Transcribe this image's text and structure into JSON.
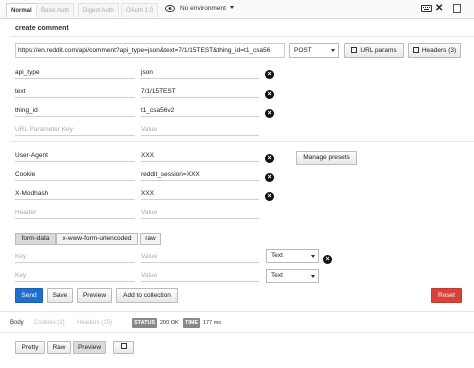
{
  "topbar": {
    "tabs": [
      "Normal",
      "Basic Auth",
      "Digest Auth",
      "OAuth 1.0"
    ],
    "environment": "No environment"
  },
  "request": {
    "title": "create comment",
    "url": "https://en.reddit.com/api/comment?api_type=json&text=7/1/15TEST&thing_id=t1_csa56",
    "method": "POST",
    "url_params_label": "URL params",
    "headers_label": "Headers (3)"
  },
  "params": [
    {
      "key": "api_type",
      "value": "json"
    },
    {
      "key": "text",
      "value": "7/1/15TEST"
    },
    {
      "key": "thing_id",
      "value": "t1_csa56v2"
    }
  ],
  "params_placeholder": {
    "key": "URL Parameter Key",
    "value": "Value"
  },
  "headers": [
    {
      "key": "User-Agent",
      "value": "XXX"
    },
    {
      "key": "Cookie",
      "value": "reddit_session=XXX"
    },
    {
      "key": "X-Modhash",
      "value": "XXX"
    }
  ],
  "headers_placeholder": {
    "key": "Header",
    "value": "Value"
  },
  "manage_presets_label": "Manage presets",
  "body_tabs": [
    "form-data",
    "x-www-form-urlencoded",
    "raw"
  ],
  "form_rows": [
    {
      "key": "Key",
      "value": "Value",
      "type": "Text"
    },
    {
      "key": "Key",
      "value": "Value",
      "type": "Text"
    }
  ],
  "actions": {
    "send": "Send",
    "save": "Save",
    "preview": "Preview",
    "add_to_collection": "Add to collection",
    "reset": "Reset"
  },
  "response": {
    "tabs": [
      "Body",
      "Cookies (2)",
      "Headers (15)"
    ],
    "status_label": "STATUS",
    "status_value": "200 OK",
    "time_label": "TIME",
    "time_value": "177 ms",
    "view_buttons": [
      "Pretty",
      "Raw",
      "Preview"
    ]
  },
  "colors": {
    "send": "#1f6fd0",
    "reset": "#d9413b"
  }
}
